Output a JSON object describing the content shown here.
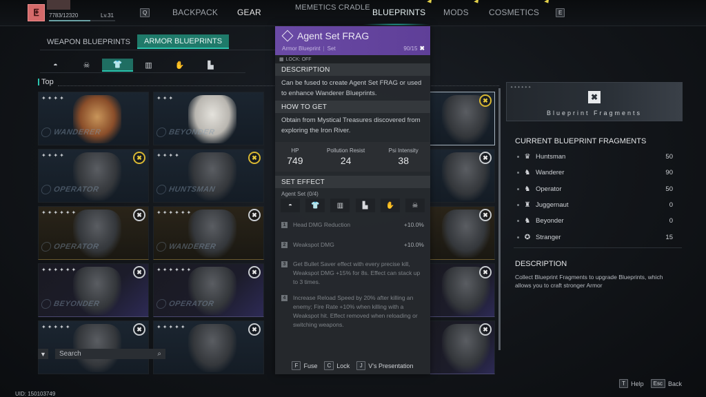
{
  "player": {
    "xp": "7783/12320",
    "xp_progress": 0.63,
    "level": "Lv.31",
    "uid": "UID: 150103749"
  },
  "nav": {
    "prev_key": "Q",
    "next_key": "E",
    "items": [
      {
        "label": "BACKPACK",
        "active": false
      },
      {
        "label": "GEAR",
        "active": false
      },
      {
        "label": "MEMETICS CRADLE",
        "active": false
      },
      {
        "label": "BLUEPRINTS",
        "active": true
      },
      {
        "label": "MODS",
        "active": false
      },
      {
        "label": "COSMETICS",
        "active": false
      }
    ]
  },
  "blueprint_tabs": [
    {
      "label": "WEAPON BLUEPRINTS",
      "active": false
    },
    {
      "label": "ARMOR BLUEPRINTS",
      "active": true
    }
  ],
  "categories": [
    {
      "icon": "helmet-icon",
      "glyph": "◓",
      "active": false
    },
    {
      "icon": "mask-icon",
      "glyph": "☠",
      "active": false
    },
    {
      "icon": "top-icon",
      "glyph": "👕",
      "active": true
    },
    {
      "icon": "pants-icon",
      "glyph": "▥",
      "active": false
    },
    {
      "icon": "gloves-icon",
      "glyph": "✋",
      "active": false
    },
    {
      "icon": "boots-icon",
      "glyph": "▙",
      "active": false
    }
  ],
  "section_label": "Top",
  "cards": [
    {
      "brand": "WANDERER",
      "stars": "✦✦✦✦",
      "style": "g-tan",
      "badge": "",
      "selected": false
    },
    {
      "brand": "BEYONDER",
      "stars": "✦✦✦",
      "style": "g-white",
      "badge": "",
      "selected": false
    },
    {
      "brand": "",
      "stars": "",
      "style": "",
      "badge": "gold",
      "selected": true
    },
    {
      "brand": "OPERATOR",
      "stars": "✦✦✦✦",
      "style": "",
      "badge": "gold",
      "selected": false
    },
    {
      "brand": "HUNTSMAN",
      "stars": "✦✦✦✦",
      "style": "",
      "badge": "gold",
      "selected": false
    },
    {
      "brand": "",
      "stars": "",
      "style": "",
      "badge": "white",
      "selected": false
    },
    {
      "brand": "OPERATOR",
      "stars": "✦✦✦✦✦✦",
      "style": "gold",
      "badge": "white",
      "selected": false
    },
    {
      "brand": "WANDERER",
      "stars": "✦✦✦✦✦✦",
      "style": "gold",
      "badge": "white",
      "selected": false
    },
    {
      "brand": "",
      "stars": "",
      "style": "gold",
      "badge": "white",
      "selected": false
    },
    {
      "brand": "BEYONDER",
      "stars": "✦✦✦✦✦✦",
      "style": "purple",
      "badge": "white",
      "selected": false
    },
    {
      "brand": "OPERATOR",
      "stars": "✦✦✦✦✦✦",
      "style": "purple",
      "badge": "white",
      "selected": false
    },
    {
      "brand": "",
      "stars": "",
      "style": "purple",
      "badge": "white",
      "selected": false
    },
    {
      "brand": "",
      "stars": "✦✦✦✦✦",
      "style": "",
      "badge": "white",
      "selected": false
    },
    {
      "brand": "",
      "stars": "✦✦✦✦✦",
      "style": "",
      "badge": "white",
      "selected": false
    },
    {
      "brand": "",
      "stars": "",
      "style": "purple",
      "badge": "white",
      "selected": false
    }
  ],
  "search": {
    "placeholder": "Search",
    "value": ""
  },
  "detail": {
    "title": "Agent Set FRAG",
    "type": "Armor Blueprint",
    "subtype": "Set",
    "count": "90/15",
    "lock_status": "LOCK: OFF",
    "description_header": "DESCRIPTION",
    "description": "Can be fused to create Agent Set FRAG or used to enhance Wanderer Blueprints.",
    "how_to_get_header": "HOW TO GET",
    "how_to_get": "Obtain from Mystical Treasures discovered from exploring the Iron River.",
    "stats": [
      {
        "label": "HP",
        "value": "749"
      },
      {
        "label": "Pollution Resist",
        "value": "24"
      },
      {
        "label": "Psi Intensity",
        "value": "38"
      }
    ],
    "set_effect_header": "SET EFFECT",
    "set_name": "Agent Set (0/4)",
    "set_pieces": [
      {
        "icon": "helmet-icon",
        "glyph": "◓"
      },
      {
        "icon": "top-icon",
        "glyph": "👕"
      },
      {
        "icon": "pants-icon",
        "glyph": "▥"
      },
      {
        "icon": "boots-icon",
        "glyph": "▙"
      },
      {
        "icon": "gloves-icon",
        "glyph": "✋"
      },
      {
        "icon": "mask-icon",
        "glyph": "☠"
      }
    ],
    "effects": [
      {
        "num": "1",
        "text": "Head DMG Reduction",
        "value": "+10.0%"
      },
      {
        "num": "2",
        "text": "Weakspot DMG",
        "value": "+10.0%"
      },
      {
        "num": "3",
        "text": "Get Bullet Saver effect with every precise kill, Weakspot DMG +15% for 8s. Effect can stack up to 3 times.",
        "value": ""
      },
      {
        "num": "4",
        "text": "Increase Reload Speed by 20% after killing an enemy; Fire Rate +10% when killing with a Weakspot hit. Effect removed when reloading or switching weapons.",
        "value": ""
      }
    ],
    "actions": [
      {
        "key": "F",
        "label": "Fuse"
      },
      {
        "key": "C",
        "label": "Lock"
      },
      {
        "key": "J",
        "label": "V's Presentation"
      }
    ]
  },
  "fragments": {
    "banner_label": "Blueprint Fragments",
    "title": "CURRENT BLUEPRINT FRAGMENTS",
    "items": [
      {
        "name": "Huntsman",
        "value": "50",
        "glyph": "♛"
      },
      {
        "name": "Wanderer",
        "value": "90",
        "glyph": "♞"
      },
      {
        "name": "Operator",
        "value": "50",
        "glyph": "♞"
      },
      {
        "name": "Juggernaut",
        "value": "0",
        "glyph": "♜"
      },
      {
        "name": "Beyonder",
        "value": "0",
        "glyph": "♞"
      },
      {
        "name": "Stranger",
        "value": "15",
        "glyph": "✪"
      }
    ],
    "description_title": "DESCRIPTION",
    "description": "Collect Blueprint Fragments to upgrade Blueprints, which allows you to craft stronger Armor"
  },
  "hints": [
    {
      "key": "T",
      "label": "Help"
    },
    {
      "key": "Esc",
      "label": "Back"
    }
  ]
}
